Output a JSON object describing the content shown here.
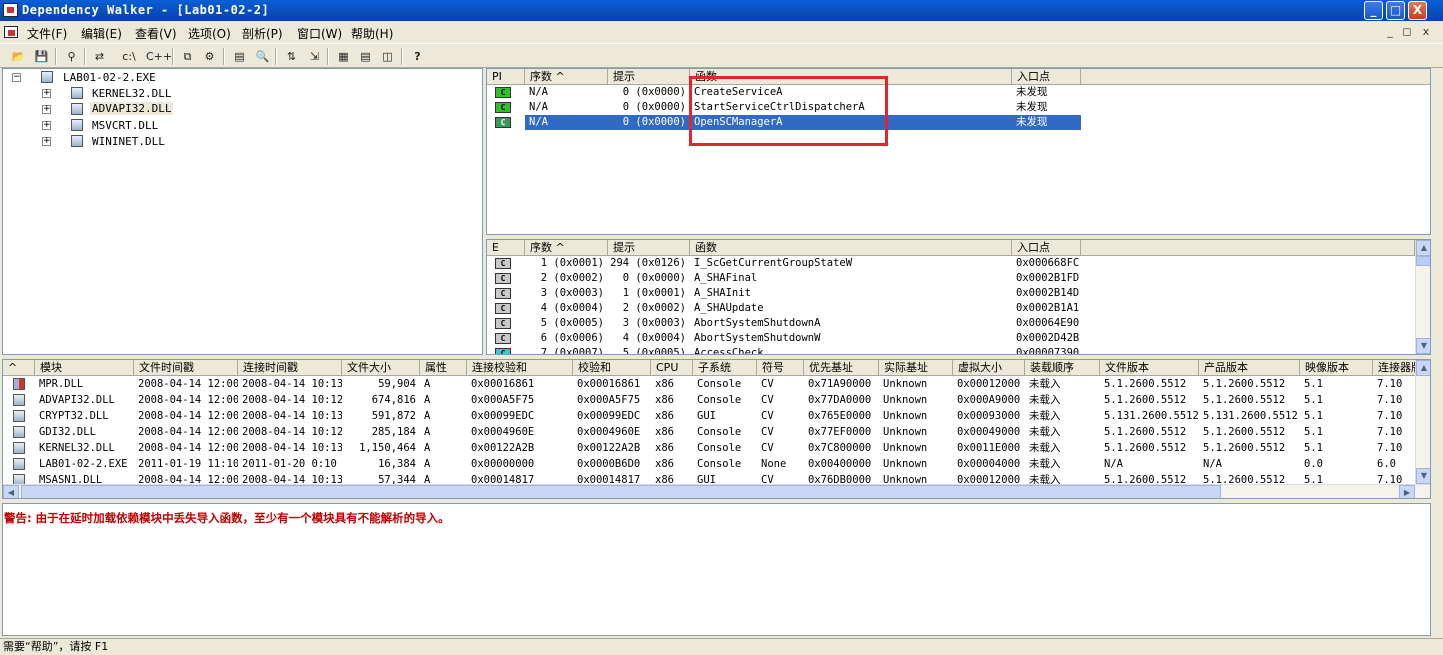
{
  "window": {
    "title": "Dependency Walker - [Lab01-02-2]",
    "buttons": [
      "_",
      "□",
      "X"
    ]
  },
  "menu": [
    "文件(F)",
    "编辑(E)",
    "查看(V)",
    "选项(O)",
    "剖析(P)",
    "窗口(W)",
    "帮助(H)"
  ],
  "mdi_buttons": [
    "_",
    "◻",
    "x"
  ],
  "toolbar": [
    "📂",
    "💾",
    "⚲",
    "⇄",
    "c:\\",
    "C++",
    "⧉",
    "⚙",
    "▤",
    "🔍",
    "⇅",
    "⇲",
    "▦",
    "▤",
    "◫",
    "?"
  ],
  "tree": {
    "root": "LAB01-02-2.EXE",
    "children": [
      "KERNEL32.DLL",
      "ADVAPI32.DLL",
      "MSVCRT.DLL",
      "WININET.DLL"
    ]
  },
  "imports": {
    "headers": [
      "PI",
      "序数 ^",
      "提示",
      "函数",
      "入口点"
    ],
    "rows": [
      {
        "icon": "C",
        "ordinal": "N/A",
        "hint": "0 (0x0000)",
        "func": "CreateServiceA",
        "entry": "未发现"
      },
      {
        "icon": "C",
        "ordinal": "N/A",
        "hint": "0 (0x0000)",
        "func": "StartServiceCtrlDispatcherA",
        "entry": "未发现"
      },
      {
        "icon": "C",
        "ordinal": "N/A",
        "hint": "0 (0x0000)",
        "func": "OpenSCManagerA",
        "entry": "未发现"
      }
    ]
  },
  "exports": {
    "headers": [
      "E",
      "序数 ^",
      "提示",
      "函数",
      "入口点"
    ],
    "rows": [
      {
        "icon": "C",
        "ordinal": "1 (0x0001)",
        "hint": "294 (0x0126)",
        "func": "I_ScGetCurrentGroupStateW",
        "entry": "0x000668FC"
      },
      {
        "icon": "C",
        "ordinal": "2 (0x0002)",
        "hint": "0 (0x0000)",
        "func": "A_SHAFinal",
        "entry": "0x0002B1FD"
      },
      {
        "icon": "C",
        "ordinal": "3 (0x0003)",
        "hint": "1 (0x0001)",
        "func": "A_SHAInit",
        "entry": "0x0002B14D"
      },
      {
        "icon": "C",
        "ordinal": "4 (0x0004)",
        "hint": "2 (0x0002)",
        "func": "A_SHAUpdate",
        "entry": "0x0002B1A1"
      },
      {
        "icon": "C",
        "ordinal": "5 (0x0005)",
        "hint": "3 (0x0003)",
        "func": "AbortSystemShutdownA",
        "entry": "0x00064E90"
      },
      {
        "icon": "C",
        "ordinal": "6 (0x0006)",
        "hint": "4 (0x0004)",
        "func": "AbortSystemShutdownW",
        "entry": "0x0002D42B"
      },
      {
        "icon": "C",
        "ordinal": "7 (0x0007)",
        "hint": "5 (0x0005)",
        "func": "AccessCheck",
        "entry": "0x00007390"
      }
    ]
  },
  "modules": {
    "headers": [
      "^",
      "模块",
      "文件时间戳",
      "连接时间戳",
      "文件大小",
      "属性",
      "连接校验和",
      "校验和",
      "CPU",
      "子系统",
      "符号",
      "优先基址",
      "实际基址",
      "虚拟大小",
      "装载顺序",
      "文件版本",
      "产品版本",
      "映像版本",
      "连接器版本"
    ],
    "rows": [
      [
        "MPR.DLL",
        "2008-04-14 12:00",
        "2008-04-14 10:13",
        "59,904",
        "A",
        "0x00016861",
        "0x00016861",
        "x86",
        "Console",
        "CV",
        "0x71A90000",
        "Unknown",
        "0x00012000",
        "未载入",
        "5.1.2600.5512",
        "5.1.2600.5512",
        "5.1",
        "7.10"
      ],
      [
        "ADVAPI32.DLL",
        "2008-04-14 12:00",
        "2008-04-14 10:12",
        "674,816",
        "A",
        "0x000A5F75",
        "0x000A5F75",
        "x86",
        "Console",
        "CV",
        "0x77DA0000",
        "Unknown",
        "0x000A9000",
        "未载入",
        "5.1.2600.5512",
        "5.1.2600.5512",
        "5.1",
        "7.10"
      ],
      [
        "CRYPT32.DLL",
        "2008-04-14 12:00",
        "2008-04-14 10:13",
        "591,872",
        "A",
        "0x00099EDC",
        "0x00099EDC",
        "x86",
        "GUI",
        "CV",
        "0x765E0000",
        "Unknown",
        "0x00093000",
        "未载入",
        "5.131.2600.5512",
        "5.131.2600.5512",
        "5.1",
        "7.10"
      ],
      [
        "GDI32.DLL",
        "2008-04-14 12:00",
        "2008-04-14 10:12",
        "285,184",
        "A",
        "0x0004960E",
        "0x0004960E",
        "x86",
        "Console",
        "CV",
        "0x77EF0000",
        "Unknown",
        "0x00049000",
        "未载入",
        "5.1.2600.5512",
        "5.1.2600.5512",
        "5.1",
        "7.10"
      ],
      [
        "KERNEL32.DLL",
        "2008-04-14 12:00",
        "2008-04-14 10:13",
        "1,150,464",
        "A",
        "0x00122A2B",
        "0x00122A2B",
        "x86",
        "Console",
        "CV",
        "0x7C800000",
        "Unknown",
        "0x0011E000",
        "未载入",
        "5.1.2600.5512",
        "5.1.2600.5512",
        "5.1",
        "7.10"
      ],
      [
        "LAB01-02-2.EXE",
        "2011-01-19 11:10",
        "2011-01-20  0:10",
        "16,384",
        "A",
        "0x00000000",
        "0x0000B6D0",
        "x86",
        "Console",
        "None",
        "0x00400000",
        "Unknown",
        "0x00004000",
        "未载入",
        "N/A",
        "N/A",
        "0.0",
        "6.0"
      ],
      [
        "MSASN1.DLL",
        "2008-04-14 12:00",
        "2008-04-14 10:13",
        "57,344",
        "A",
        "0x00014817",
        "0x00014817",
        "x86",
        "GUI",
        "CV",
        "0x76DB0000",
        "Unknown",
        "0x00012000",
        "未载入",
        "5.1.2600.5512",
        "5.1.2600.5512",
        "5.1",
        "7.10"
      ]
    ]
  },
  "warning": "警告: 由于在延时加载依赖模块中丢失导入函数，至少有一个模块具有不能解析的导入。",
  "status": "需要“帮助”，请按 F1",
  "colors": {
    "title": "#0842a8",
    "selection": "#316ac5",
    "highlight_box": "#e0262c",
    "warning": "#c00000"
  }
}
